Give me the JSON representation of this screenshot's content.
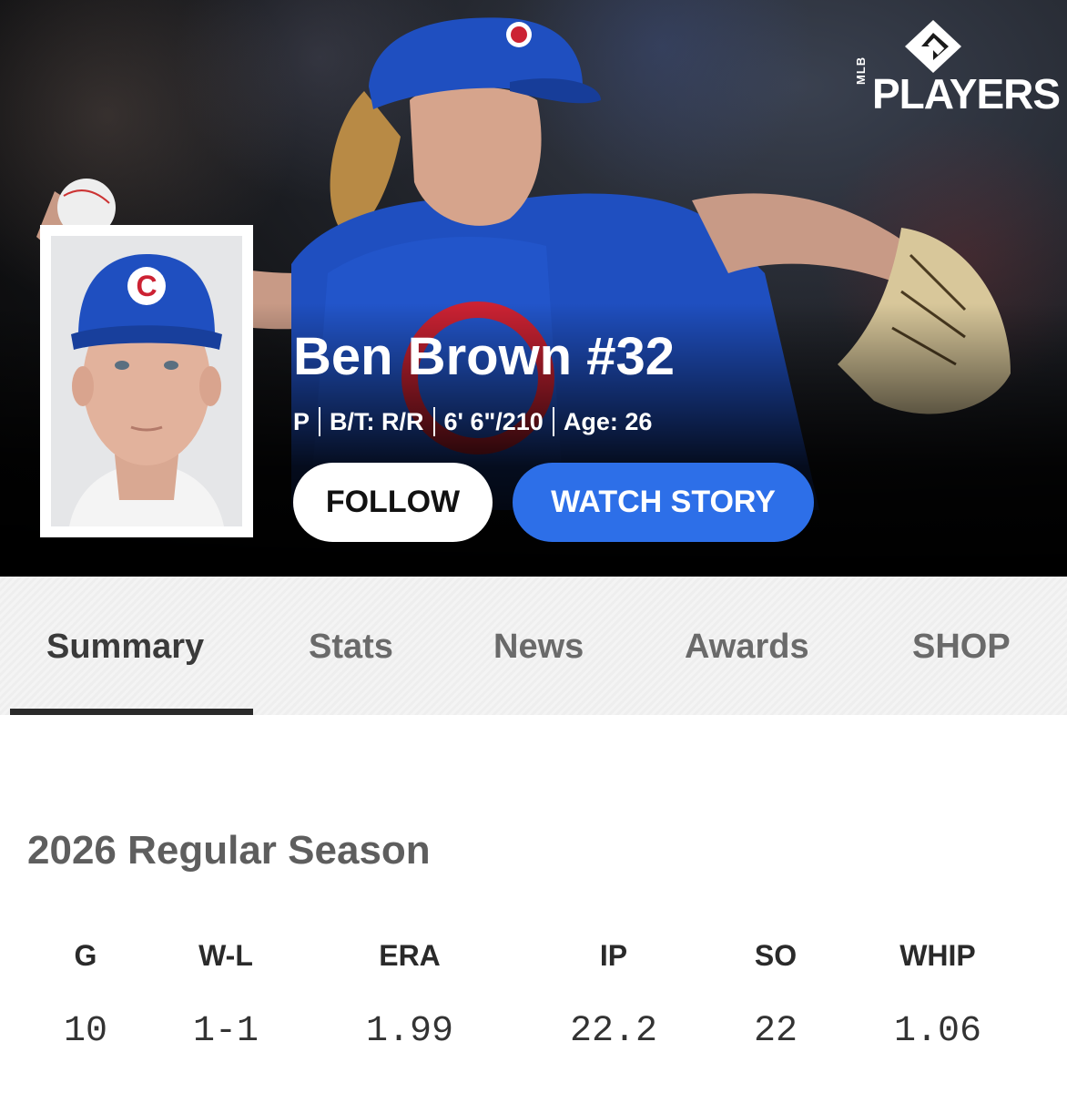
{
  "hero": {
    "brand": {
      "mlb": "MLB",
      "players": "PLAYERS"
    },
    "player_name": "Ben Brown #32",
    "meta": [
      "P",
      "B/T: R/R",
      "6' 6\"/210",
      "Age: 26"
    ],
    "follow_label": "FOLLOW",
    "watch_label": "WATCH STORY",
    "colors": {
      "watch_button": "#2d6fe8",
      "cubs_blue": "#1f4fc0",
      "cubs_red": "#cc2233"
    }
  },
  "tabs": [
    {
      "label": "Summary",
      "active": true
    },
    {
      "label": "Stats",
      "active": false
    },
    {
      "label": "News",
      "active": false
    },
    {
      "label": "Awards",
      "active": false
    },
    {
      "label": "SHOP",
      "active": false
    }
  ],
  "season": {
    "title": "2026 Regular Season",
    "headers": [
      "G",
      "W-L",
      "ERA",
      "IP",
      "SO",
      "WHIP"
    ],
    "values": [
      "10",
      "1-1",
      "1.99",
      "22.2",
      "22",
      "1.06"
    ]
  }
}
